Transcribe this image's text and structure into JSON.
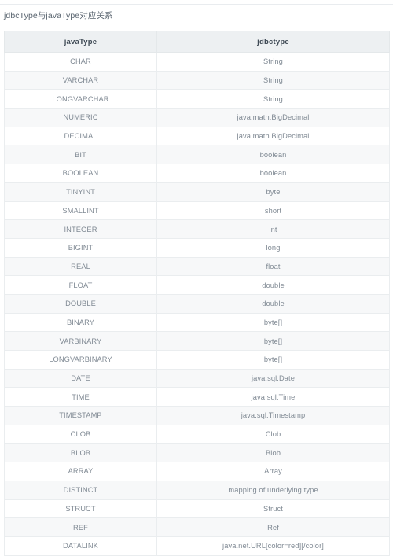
{
  "document": {
    "title": "jdbcType与javaType对应关系"
  },
  "table": {
    "columns": [
      "javaType",
      "jdbctype"
    ],
    "rows": [
      [
        "CHAR",
        "String"
      ],
      [
        "VARCHAR",
        "String"
      ],
      [
        "LONGVARCHAR",
        "String"
      ],
      [
        "NUMERIC",
        "java.math.BigDecimal"
      ],
      [
        "DECIMAL",
        "java.math.BigDecimal"
      ],
      [
        "BIT",
        "boolean"
      ],
      [
        "BOOLEAN",
        "boolean"
      ],
      [
        "TINYINT",
        "byte"
      ],
      [
        "SMALLINT",
        "short"
      ],
      [
        "INTEGER",
        "int"
      ],
      [
        "BIGINT",
        "long"
      ],
      [
        "REAL",
        "float"
      ],
      [
        "FLOAT",
        "double"
      ],
      [
        "DOUBLE",
        "double"
      ],
      [
        "BINARY",
        "byte[]"
      ],
      [
        "VARBINARY",
        "byte[]"
      ],
      [
        "LONGVARBINARY",
        "byte[]"
      ],
      [
        "DATE",
        "java.sql.Date"
      ],
      [
        "TIME",
        "java.sql.Time"
      ],
      [
        "TIMESTAMP",
        "java.sql.Timestamp"
      ],
      [
        "CLOB",
        "Clob"
      ],
      [
        "BLOB",
        "Blob"
      ],
      [
        "ARRAY",
        "Array"
      ],
      [
        "DISTINCT",
        "mapping of underlying type"
      ],
      [
        "STRUCT",
        "Struct"
      ],
      [
        "REF",
        "Ref"
      ],
      [
        "DATALINK",
        "java.net.URL[color=red][/color]"
      ]
    ]
  },
  "colors": {
    "header_background": "#edf0f2",
    "header_text": "#3f4a55",
    "row_text": "#808a94",
    "row_alt_background": "#f7f8f9",
    "border": "#eaedef",
    "title_text": "#5a6570"
  }
}
